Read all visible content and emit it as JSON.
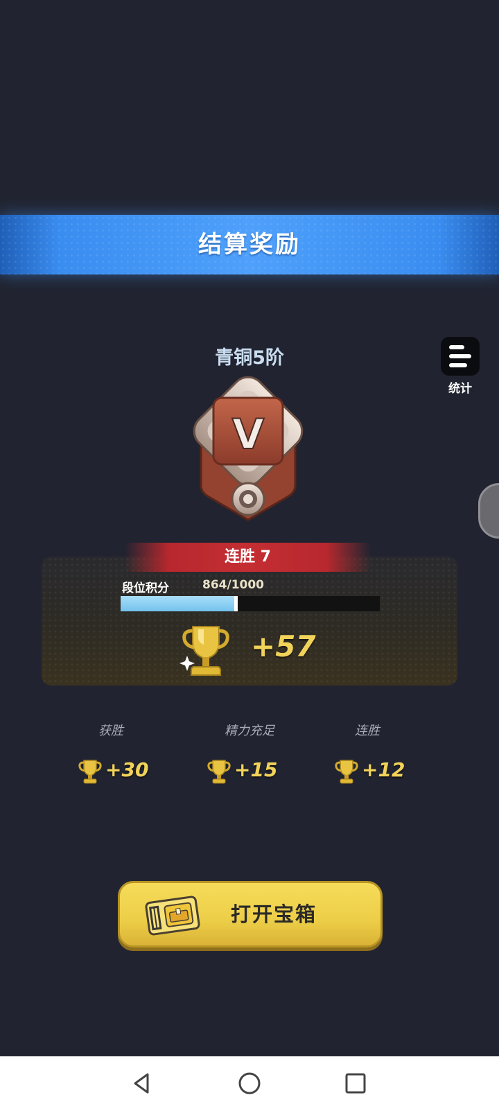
{
  "header": {
    "title": "结算奖励"
  },
  "rank": {
    "name": "青铜5阶",
    "emblem_letter": "V"
  },
  "stats_button": {
    "label": "统计",
    "icon": "list-icon"
  },
  "streak": {
    "label": "连胜 7"
  },
  "progress": {
    "label": "段位积分",
    "value_text": "864/1000",
    "current": 864,
    "max": 1000,
    "fill_fraction": 0.45
  },
  "reward": {
    "total": "+57",
    "icon": "trophy-icon"
  },
  "breakdown": [
    {
      "label": "获胜",
      "value": "+30"
    },
    {
      "label": "精力充足",
      "value": "+15"
    },
    {
      "label": "连胜",
      "value": "+12"
    }
  ],
  "open_chest_button": {
    "label": "打开宝箱",
    "icon": "chest-ticket-icon"
  },
  "navigation": {
    "back": "back-icon",
    "home": "home-icon",
    "recents": "recents-icon"
  },
  "colors": {
    "background": "#212430",
    "banner": "#3a8df0",
    "gold": "#f2d35a",
    "streak_red": "#c42e33",
    "progress_blue": "#8fd0f5"
  }
}
